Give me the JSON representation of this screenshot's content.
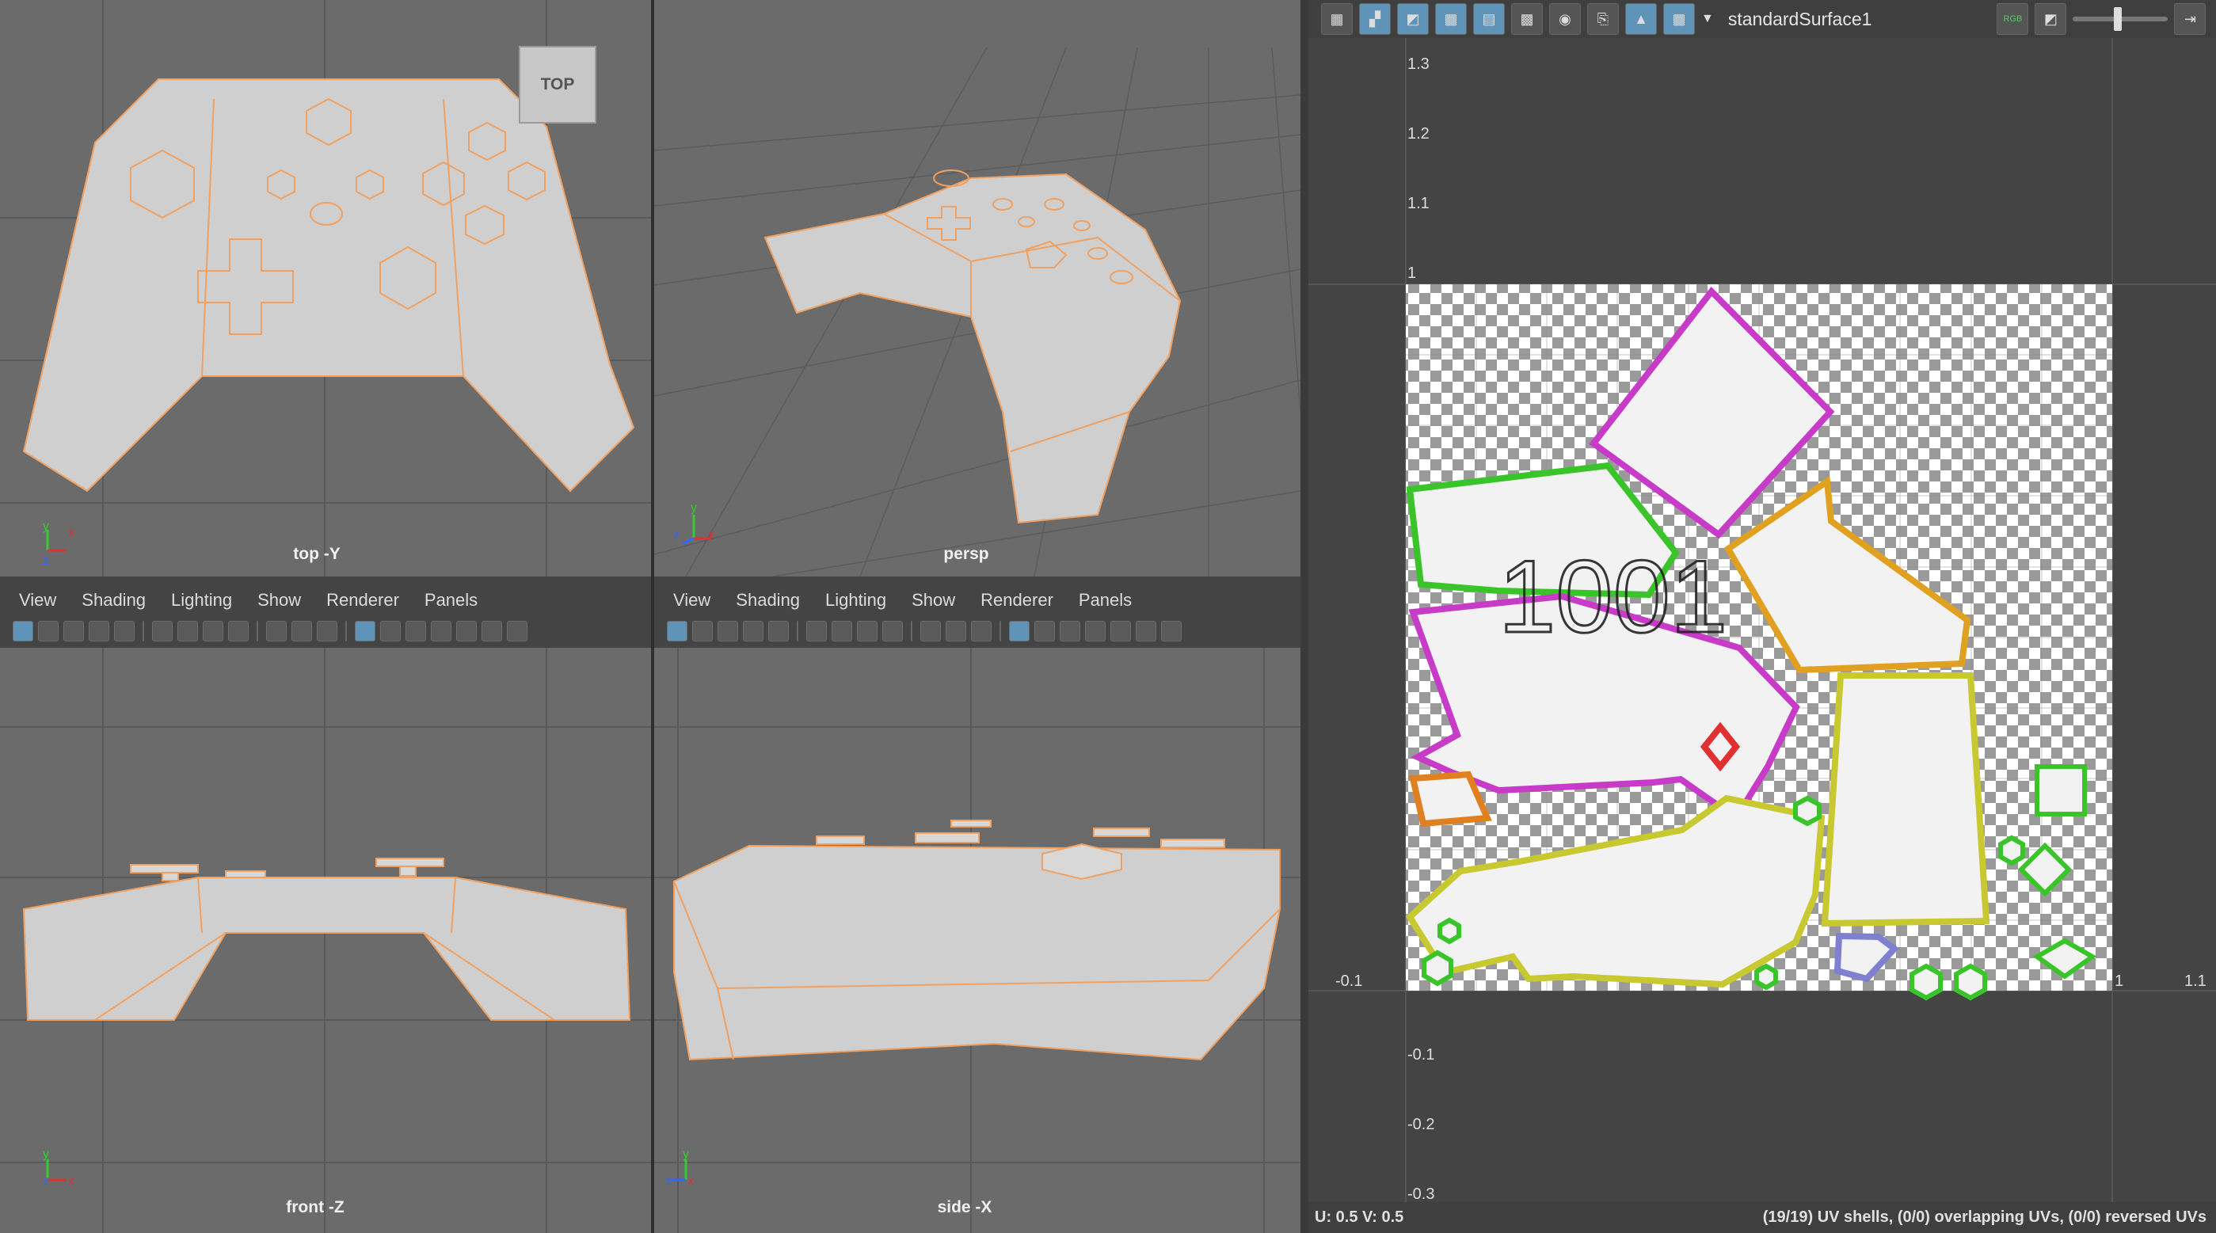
{
  "viewports": {
    "top": {
      "label": "top -Y",
      "viewcube": "TOP"
    },
    "persp": {
      "label": "persp"
    },
    "front": {
      "label": "front -Z"
    },
    "side": {
      "label": "side -X"
    }
  },
  "panel_menu": {
    "left": [
      "View",
      "Shading",
      "Lighting",
      "Show",
      "Renderer",
      "Panels"
    ],
    "right": [
      "View",
      "Shading",
      "Lighting",
      "Show",
      "Renderer",
      "Panels"
    ]
  },
  "uv_editor": {
    "material": "standardSurface1",
    "rgb_label": "RGB",
    "axis_labels_v": [
      "1.3",
      "1.2",
      "1.1",
      "1",
      "-0.1",
      "-0.2",
      "-0.3"
    ],
    "axis_labels_u": [
      "-0.1",
      "1",
      "1.1"
    ],
    "uv_readout": "U:  0.5 V:  0.5",
    "shell_status": "(19/19) UV shells, (0/0) overlapping UVs, (0/0) reversed UVs",
    "tile_text": "1001"
  },
  "colors": {
    "viewport_bg": "#6b6b6b",
    "mesh_fill": "#cfcfcf",
    "wire": "#f0a060",
    "accent_blue": "#5f93b7",
    "uv_green": "#39c52a"
  },
  "axis_gizmo": {
    "y": "y",
    "x": "x",
    "z": "z"
  }
}
